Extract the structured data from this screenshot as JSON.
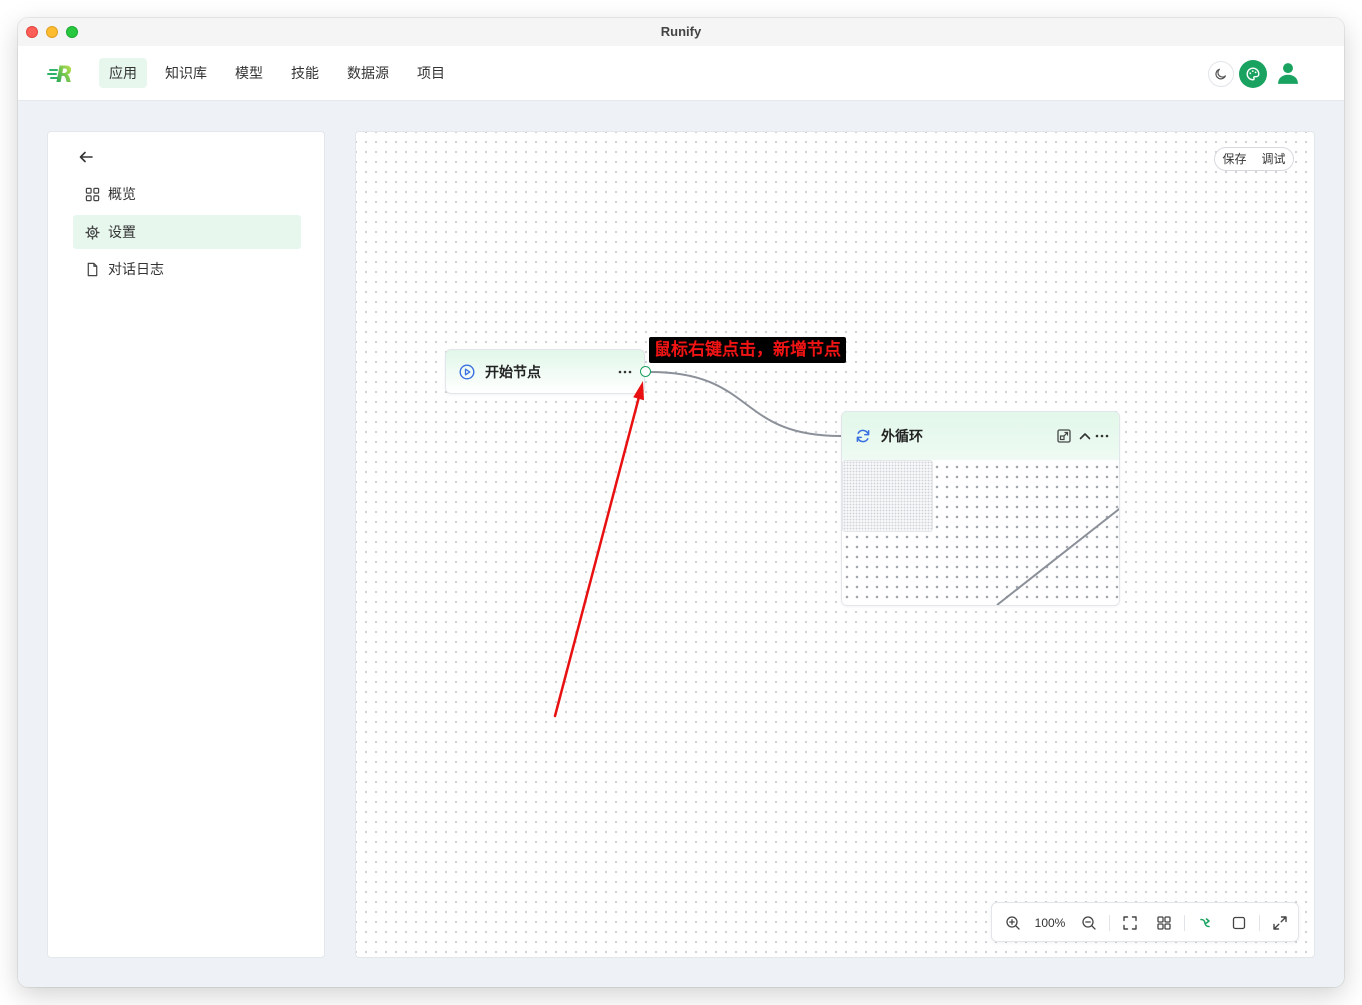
{
  "window": {
    "title": "Runify"
  },
  "header": {
    "logo_text": "R",
    "nav": [
      {
        "label": "应用",
        "active": true
      },
      {
        "label": "知识库",
        "active": false
      },
      {
        "label": "模型",
        "active": false
      },
      {
        "label": "技能",
        "active": false
      },
      {
        "label": "数据源",
        "active": false
      },
      {
        "label": "项目",
        "active": false
      }
    ],
    "icons": {
      "theme": "moon-icon",
      "palette": "palette-icon",
      "user": "user-icon"
    }
  },
  "sidebar": {
    "back_icon": "arrow-left-icon",
    "items": [
      {
        "label": "概览",
        "icon": "grid-icon",
        "active": false
      },
      {
        "label": "设置",
        "icon": "gear-icon",
        "active": true
      },
      {
        "label": "对话日志",
        "icon": "file-icon",
        "active": false
      }
    ]
  },
  "canvas": {
    "actions": {
      "save_label": "保存",
      "debug_label": "调试"
    },
    "annotation": "鼠标右键点击，新增节点",
    "start_node": {
      "title": "开始节点",
      "icon": "play-circle-icon",
      "menu_icon": "more-icon"
    },
    "loop_node": {
      "title": "外循环",
      "icon": "refresh-icon",
      "header_icons": [
        "expand-window-icon",
        "chevron-up-icon",
        "more-icon"
      ]
    },
    "controls": {
      "zoom_level": "100%",
      "icons": [
        "zoom-in-icon",
        "zoom-out-icon",
        "fit-view-icon",
        "grid-view-icon",
        "auto-layout-icon",
        "select-box-icon",
        "fullscreen-icon"
      ]
    }
  },
  "colors": {
    "accent": "#1aa260",
    "active_bg": "#e7f7ee",
    "node_icon": "#3a6fe2",
    "edge": "#8b9099",
    "annotation_text": "#f01414",
    "annotation_bg": "#000000",
    "arrow": "#e81010"
  }
}
